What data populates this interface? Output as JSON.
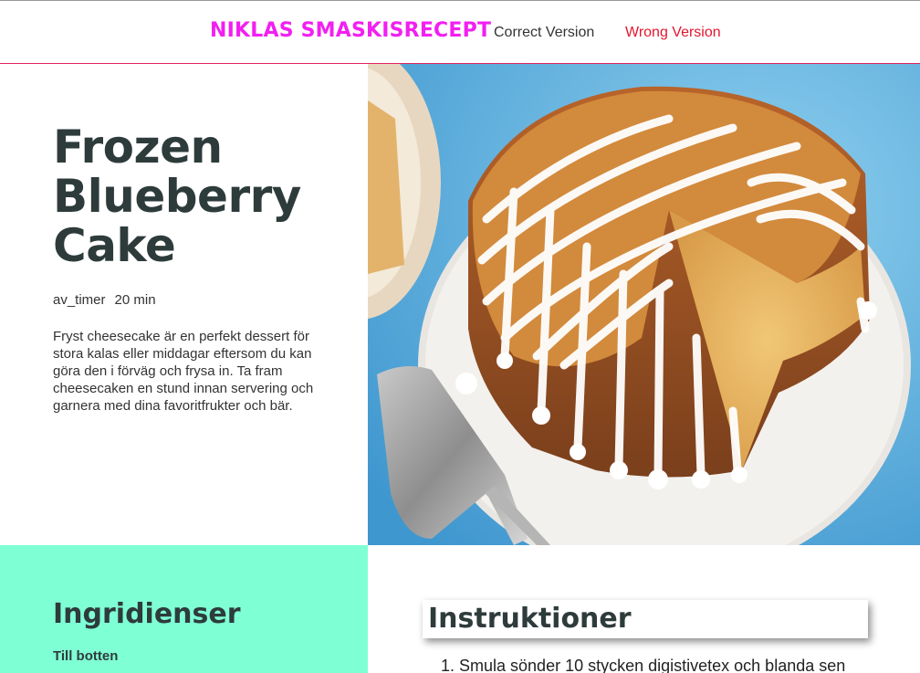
{
  "nav": {
    "brand": "NIKLAS SMASKISRECEPT",
    "links": [
      "Correct Version",
      "Wrong Version"
    ]
  },
  "recipe": {
    "title_lines": [
      "Frozen",
      "Blueberry",
      "Cake"
    ],
    "timer_icon": "av_timer",
    "time": "20 min",
    "description": "Fryst cheesecake är en perfekt dessert för stora kalas eller middagar eftersom du kan göra den i förväg och frysa in. Ta fram cheesecaken en stund innan servering och garnera med dina favoritfrukter och bär.",
    "image_icon": "cake-photo"
  },
  "ingredients": {
    "title": "Ingridienser",
    "section": "Till botten"
  },
  "instructions": {
    "title": "Instruktioner",
    "steps": [
      "Smula sönder 10 stycken digistivetex och blanda sen"
    ]
  },
  "colors": {
    "brand": "#f21ff2",
    "wrong_link": "#e3162e",
    "ingredients_bg": "#7fffd4",
    "heading": "#2e3b3b"
  }
}
